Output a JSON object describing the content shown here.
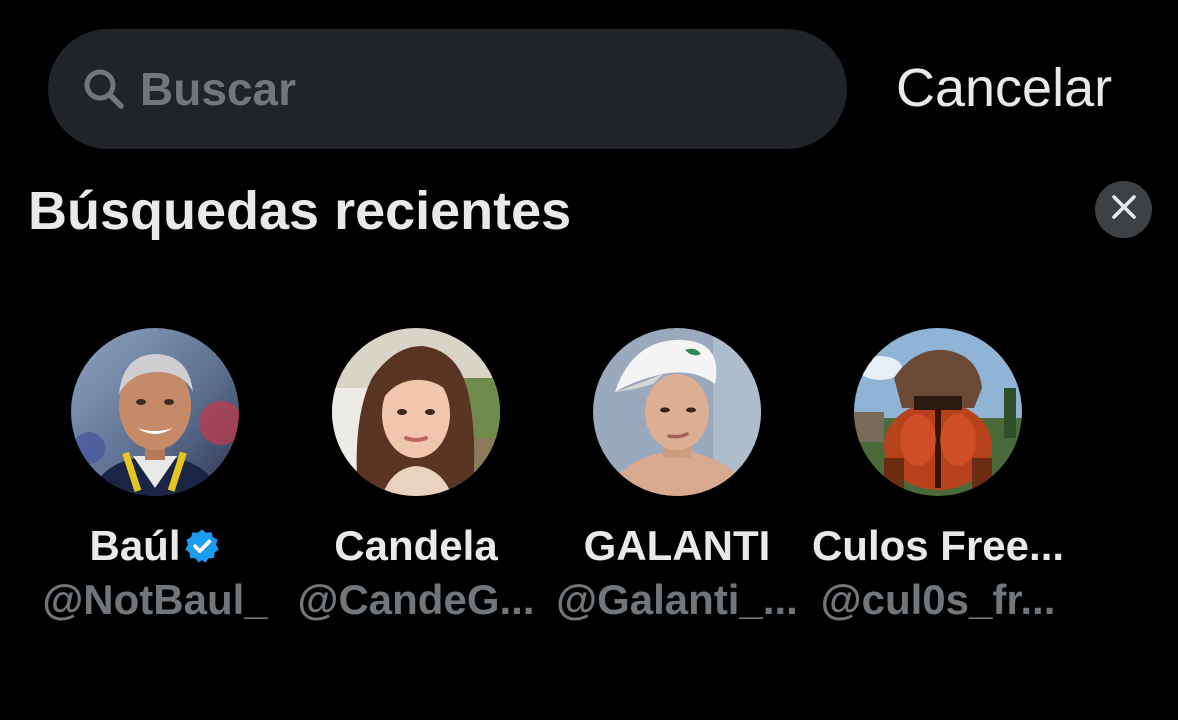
{
  "search": {
    "placeholder": "Buscar",
    "value": "",
    "cancel_label": "Cancelar"
  },
  "recent": {
    "title": "Búsquedas recientes",
    "clear_icon": "close-icon",
    "items": [
      {
        "name": "Baúl",
        "handle": "@NotBaul_",
        "verified": true
      },
      {
        "name": "Candela",
        "handle": "@CandeG..."
      },
      {
        "name": "GALANTI",
        "handle": "@Galanti_..."
      },
      {
        "name": "Culos Free...",
        "handle": "@cul0s_fr..."
      }
    ]
  },
  "colors": {
    "background": "#000000",
    "search_bg": "#202327",
    "primary_text": "#e7e9ea",
    "secondary_text": "#71767b",
    "verified_blue": "#1d9bf0",
    "clear_button_bg": "#3e4144"
  }
}
